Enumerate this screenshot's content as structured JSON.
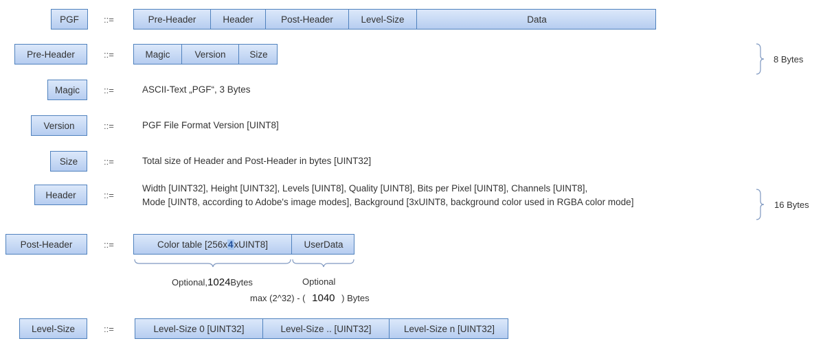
{
  "rows": {
    "pgf": {
      "name": "PGF",
      "def": "::=",
      "parts": [
        "Pre-Header",
        "Header",
        "Post-Header",
        "Level-Size",
        "Data"
      ]
    },
    "preheader": {
      "name": "Pre-Header",
      "def": "::=",
      "parts": [
        "Magic",
        "Version",
        "Size"
      ],
      "size_note": "8 Bytes"
    },
    "magic": {
      "name": "Magic",
      "def": "::=",
      "text": "ASCII-Text „PGF“, 3 Bytes"
    },
    "version": {
      "name": "Version",
      "def": "::=",
      "text": "PGF File Format Version [UINT8]"
    },
    "size": {
      "name": "Size",
      "def": "::=",
      "text": "Total size of Header and Post-Header in bytes [UINT32]"
    },
    "header": {
      "name": "Header",
      "def": "::=",
      "line1": "Width [UINT32], Height [UINT32], Levels [UINT8], Quality [UINT8], Bits per Pixel [UINT8], Channels [UINT8],",
      "line2": "Mode [UINT8, according to Adobe's image modes],  Background [3xUINT8, background color used in RGBA color mode]",
      "size_note": "16 Bytes"
    },
    "postheader": {
      "name": "Post-Header",
      "def": "::=",
      "color_table": {
        "prefix": "Color table [256x",
        "highlight": "4",
        "suffix": "xUINT8]"
      },
      "userdata": "UserData",
      "color_note": {
        "prefix": "Optional,",
        "number": "1024",
        "suffix": "Bytes"
      },
      "user_note": "Optional",
      "max_note": {
        "prefix": "max (2^32) - (",
        "number": "1040",
        "suffix": ") Bytes"
      }
    },
    "levelsize": {
      "name": "Level-Size",
      "def": "::=",
      "parts": [
        "Level-Size 0 [UINT32]",
        "Level-Size .. [UINT32]",
        "Level-Size n [UINT32]"
      ]
    }
  }
}
